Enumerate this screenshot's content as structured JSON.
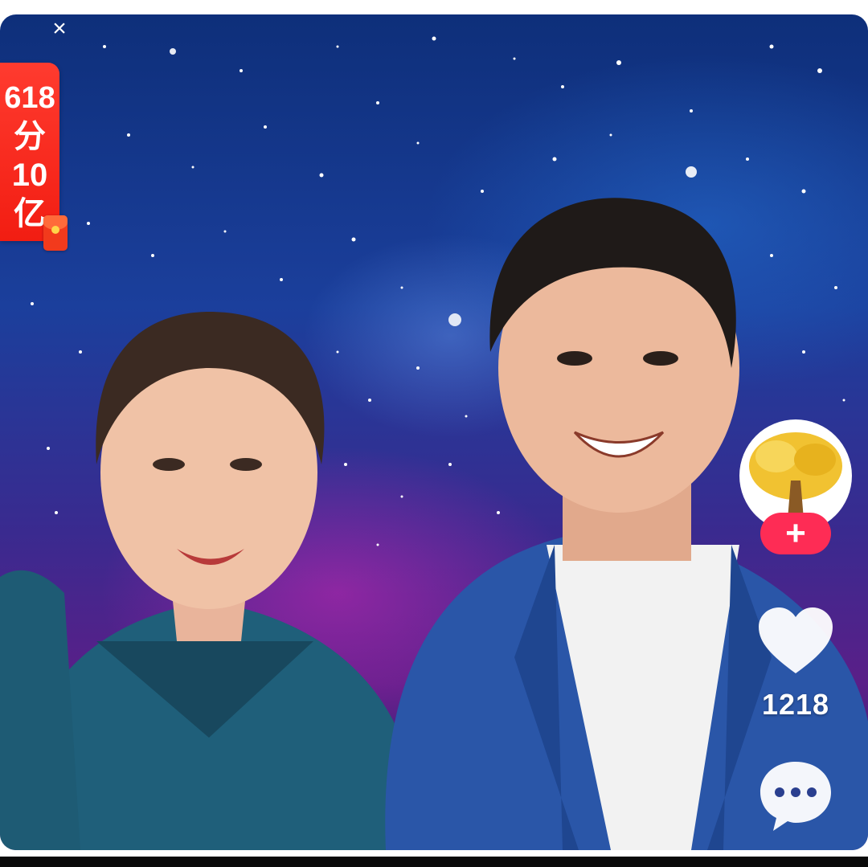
{
  "overlay": {
    "close_icon": "close-icon",
    "close_glyph": "×"
  },
  "promo": {
    "lines": [
      "618",
      "分",
      "10",
      "亿"
    ],
    "bg_color": "#f21d12",
    "icon": "red-packet-icon"
  },
  "side_actions": {
    "avatar_icon": "golden-tree-avatar",
    "follow_glyph": "+",
    "follow_color": "#fe2c55",
    "like_icon": "heart-icon",
    "like_count": "1218",
    "comment_icon": "comment-bubble-icon"
  }
}
